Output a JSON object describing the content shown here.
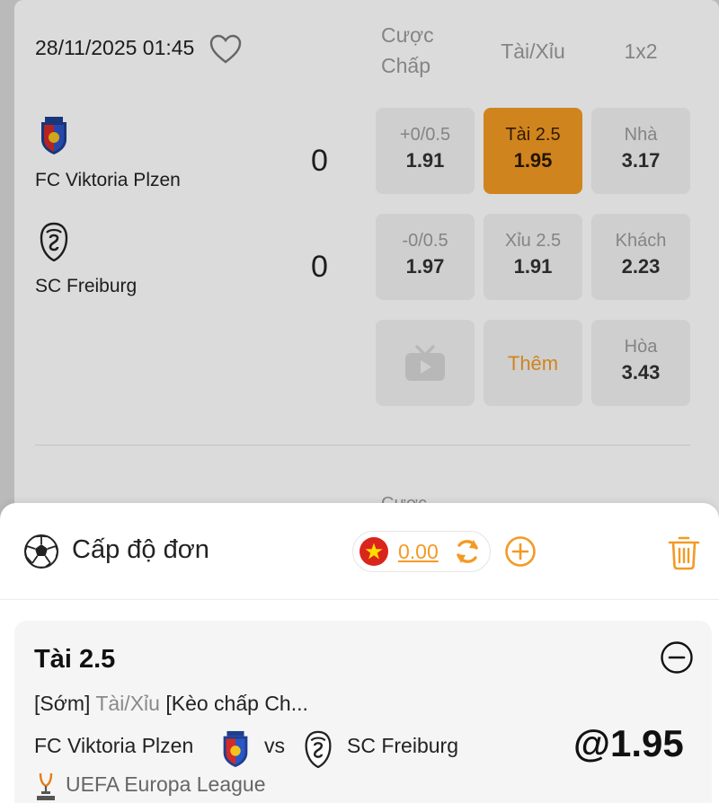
{
  "match": {
    "datetime": "28/11/2025 01:45",
    "columns": {
      "handicap": "Cược Chấp",
      "over_under": "Tài/Xỉu",
      "one_x_two": "1x2"
    },
    "home": {
      "name": "FC Viktoria Plzen",
      "score": "0"
    },
    "away": {
      "name": "SC Freiburg",
      "score": "0"
    },
    "odds": {
      "home_handicap": {
        "label": "+0/0.5",
        "value": "1.91"
      },
      "over": {
        "label": "Tài 2.5",
        "value": "1.95",
        "selected": true
      },
      "home_win": {
        "label": "Nhà",
        "value": "3.17"
      },
      "away_handicap": {
        "label": "-0/0.5",
        "value": "1.97"
      },
      "under": {
        "label": "Xỉu 2.5",
        "value": "1.91"
      },
      "away_win": {
        "label": "Khách",
        "value": "2.23"
      },
      "more": {
        "label": "Thêm"
      },
      "draw": {
        "label": "Hòa",
        "value": "3.43"
      }
    },
    "next_block_partial": "Cược"
  },
  "betslip": {
    "title": "Cấp độ đơn",
    "balance": "0.00",
    "bet": {
      "selection": "Tài 2.5",
      "timing": "[Sớm]",
      "market": "Tài/Xỉu",
      "market_desc": "[Kèo chấp Ch...",
      "home": "FC Viktoria Plzen",
      "vs": "vs",
      "away": "SC Freiburg",
      "odds": "@1.95",
      "league": "UEFA Europa League"
    }
  },
  "colors": {
    "accent": "#f39a24",
    "flag_red": "#da251d",
    "flag_star": "#ffde00"
  },
  "icons": [
    "heart-icon",
    "plzen-crest-icon",
    "freiburg-crest-icon",
    "tv-play-icon",
    "soccer-ball-icon",
    "vietnam-flag-icon",
    "refresh-icon",
    "add-circle-icon",
    "trash-icon",
    "minus-circle-icon",
    "europa-league-icon"
  ]
}
